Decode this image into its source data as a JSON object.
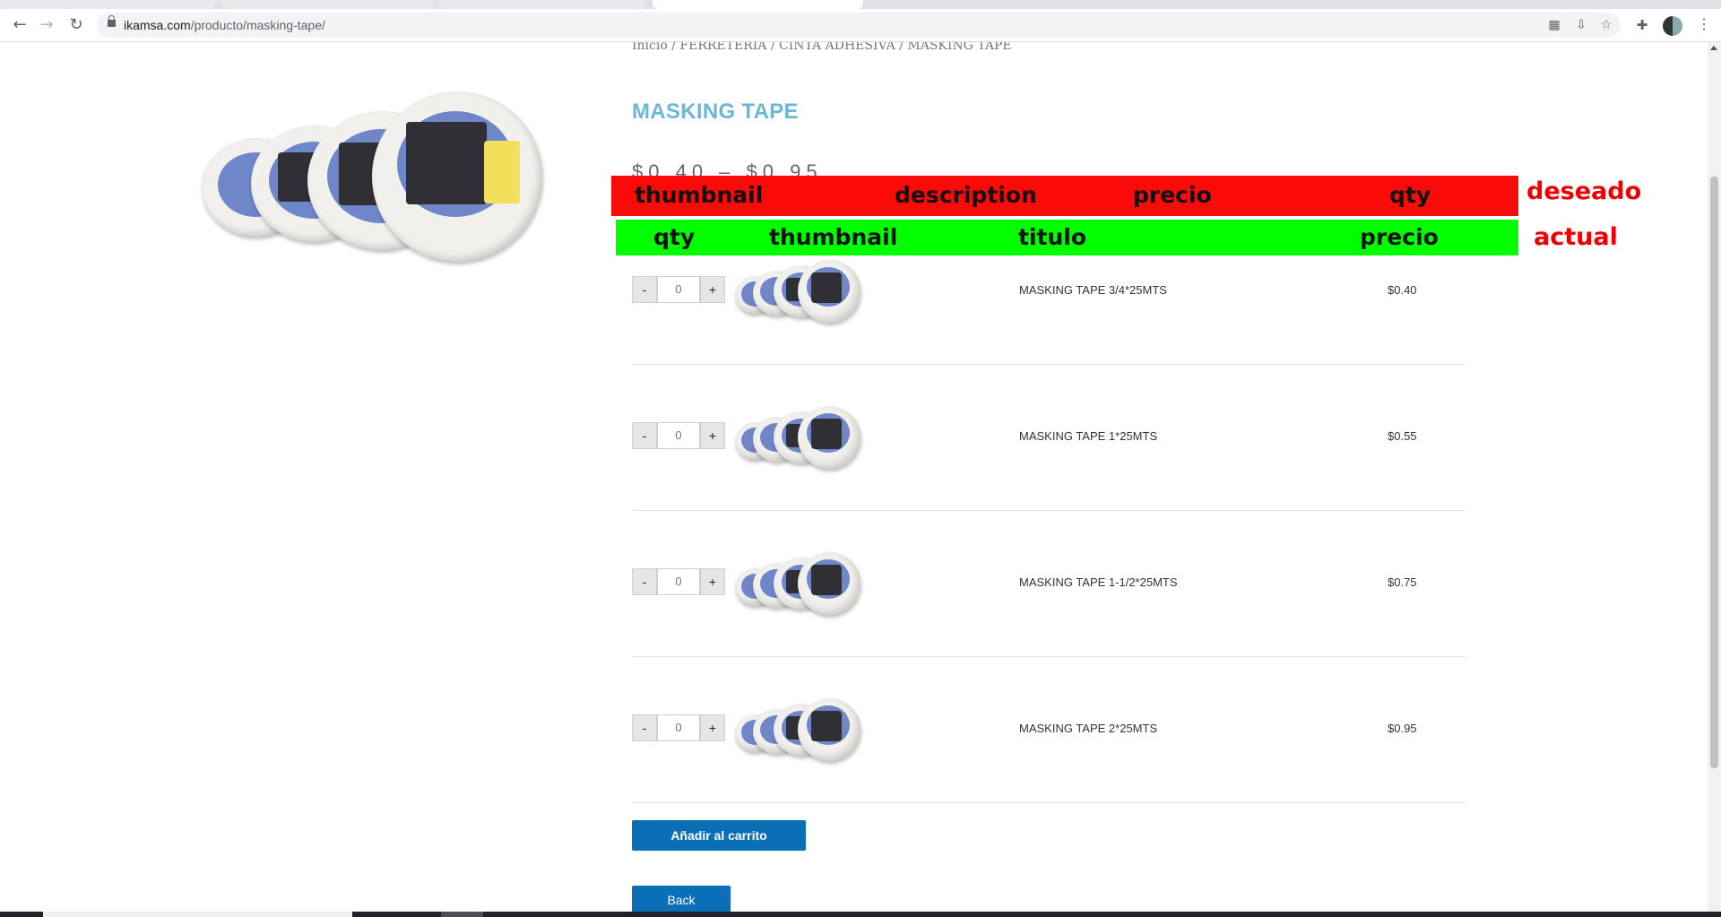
{
  "browser": {
    "url_domain": "ikamsa.com",
    "url_path": "/producto/masking-tape/"
  },
  "breadcrumb": "Inicio / FERRETERIA / CINTA ADHESIVA / MASKING TAPE",
  "product": {
    "title": "MASKING TAPE",
    "price_range": "$0.40 – $0.95"
  },
  "annotation": {
    "desired_label": "deseado",
    "desired_columns": [
      "thumbnail",
      "description",
      "precio",
      "qty"
    ],
    "actual_label": "actual",
    "actual_columns": [
      "qty",
      "thumbnail",
      "titulo",
      "precio"
    ]
  },
  "rows": [
    {
      "title": "MASKING TAPE 3/4*25MTS",
      "price": "$0.40",
      "qty": "0"
    },
    {
      "title": "MASKING TAPE 1*25MTS",
      "price": "$0.55",
      "qty": "0"
    },
    {
      "title": "MASKING TAPE 1-1/2*25MTS",
      "price": "$0.75",
      "qty": "0"
    },
    {
      "title": "MASKING TAPE 2*25MTS",
      "price": "$0.95",
      "qty": "0"
    }
  ],
  "stepper": {
    "minus": "-",
    "plus": "+"
  },
  "buttons": {
    "add_to_cart": "Añadir al carrito",
    "back": "Back"
  },
  "colors": {
    "title_accent": "#6bb7d6",
    "button_blue": "#0b6fb8",
    "desired_bar": "#fb0a0a",
    "actual_bar": "#00ff00"
  }
}
